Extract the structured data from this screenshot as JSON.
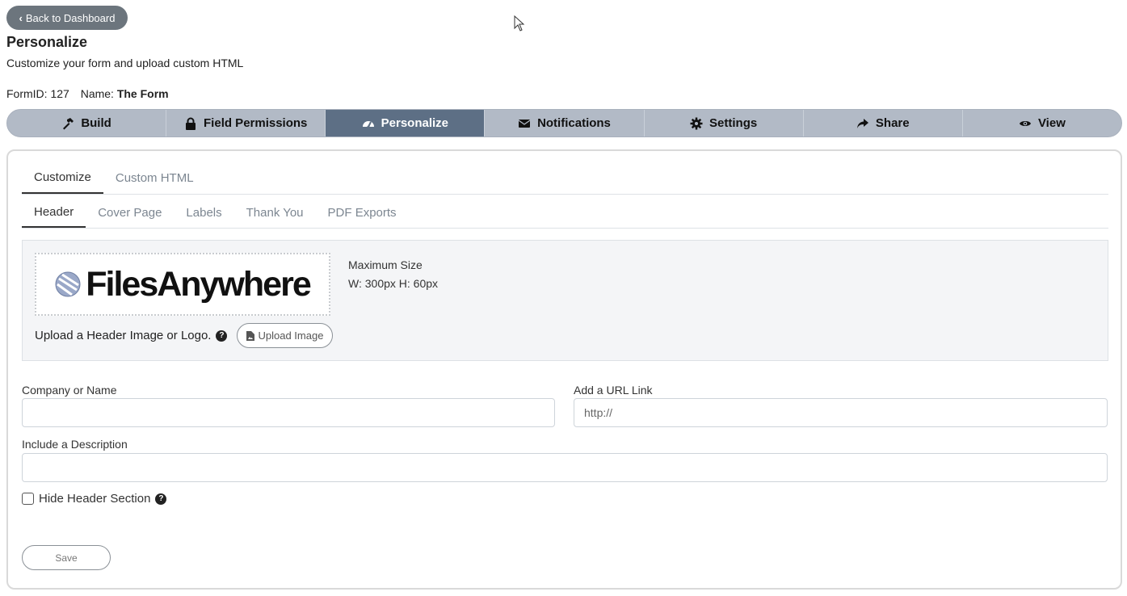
{
  "nav": {
    "back_label": "Back to Dashboard"
  },
  "page": {
    "title": "Personalize",
    "subtitle": "Customize your form and upload custom HTML",
    "form_id_label": "FormID:",
    "form_id": "127",
    "name_label": "Name:",
    "form_name": "The Form"
  },
  "main_tabs": [
    {
      "label": "Build",
      "icon": "hammer-icon",
      "active": false
    },
    {
      "label": "Field Permissions",
      "icon": "lock-icon",
      "active": false
    },
    {
      "label": "Personalize",
      "icon": "dashboard-icon",
      "active": true
    },
    {
      "label": "Notifications",
      "icon": "envelope-icon",
      "active": false
    },
    {
      "label": "Settings",
      "icon": "gear-icon",
      "active": false
    },
    {
      "label": "Share",
      "icon": "share-icon",
      "active": false
    },
    {
      "label": "View",
      "icon": "eye-icon",
      "active": false
    }
  ],
  "subtabs_level1": [
    {
      "label": "Customize",
      "active": true
    },
    {
      "label": "Custom HTML",
      "active": false
    }
  ],
  "subtabs_level2": [
    {
      "label": "Header",
      "active": true
    },
    {
      "label": "Cover Page",
      "active": false
    },
    {
      "label": "Labels",
      "active": false
    },
    {
      "label": "Thank You",
      "active": false
    },
    {
      "label": "PDF Exports",
      "active": false
    }
  ],
  "header_section": {
    "logo_text": "FilesAnywhere",
    "max_size_title": "Maximum Size",
    "max_size_value": "W: 300px H: 60px",
    "upload_prompt": "Upload a Header Image or Logo.",
    "upload_button": "Upload Image"
  },
  "fields": {
    "company_label": "Company or Name",
    "company_value": "",
    "url_label": "Add a URL Link",
    "url_value": "http://",
    "description_label": "Include a Description",
    "description_value": "",
    "hide_header_label": "Hide Header Section",
    "hide_header_checked": false
  },
  "actions": {
    "save_label": "Save"
  },
  "colors": {
    "active_tab": "#5d6f85",
    "tab_bar": "#b2bac6",
    "back_button": "#6c757d"
  }
}
